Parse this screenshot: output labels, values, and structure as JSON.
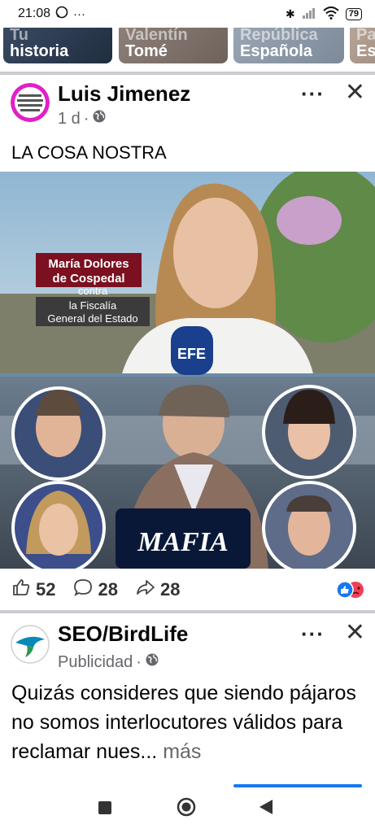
{
  "status": {
    "time": "21:08",
    "battery": "79"
  },
  "stories": [
    {
      "line1": "Tu",
      "line2": "historia"
    },
    {
      "line1": "Valentín",
      "line2": "Tomé"
    },
    {
      "line1": "República",
      "line2": "Española"
    },
    {
      "line1": "Pa",
      "line2": "Es"
    }
  ],
  "post1": {
    "author": "Luis Jimenez",
    "time": "1 d",
    "text": "LA COSA NOSTRA",
    "image": {
      "caption_name_1": "María Dolores",
      "caption_name_2": "de Cospedal",
      "caption_contra": "contra",
      "caption_target_1": "la Fiscalía",
      "caption_target_2": "General del Estado",
      "mic_label": "EFE",
      "mafia_label": "MAFIA"
    },
    "likes": "52",
    "comments": "28",
    "shares": "28"
  },
  "post2": {
    "author": "SEO/BirdLife",
    "sponsored": "Publicidad",
    "text": "Quizás consideres que siendo pájaros no somos interlocutores válidos para reclamar nues...",
    "more": "más"
  },
  "colors": {
    "accent": "#1877f2",
    "secondary_text": "#65676b"
  }
}
